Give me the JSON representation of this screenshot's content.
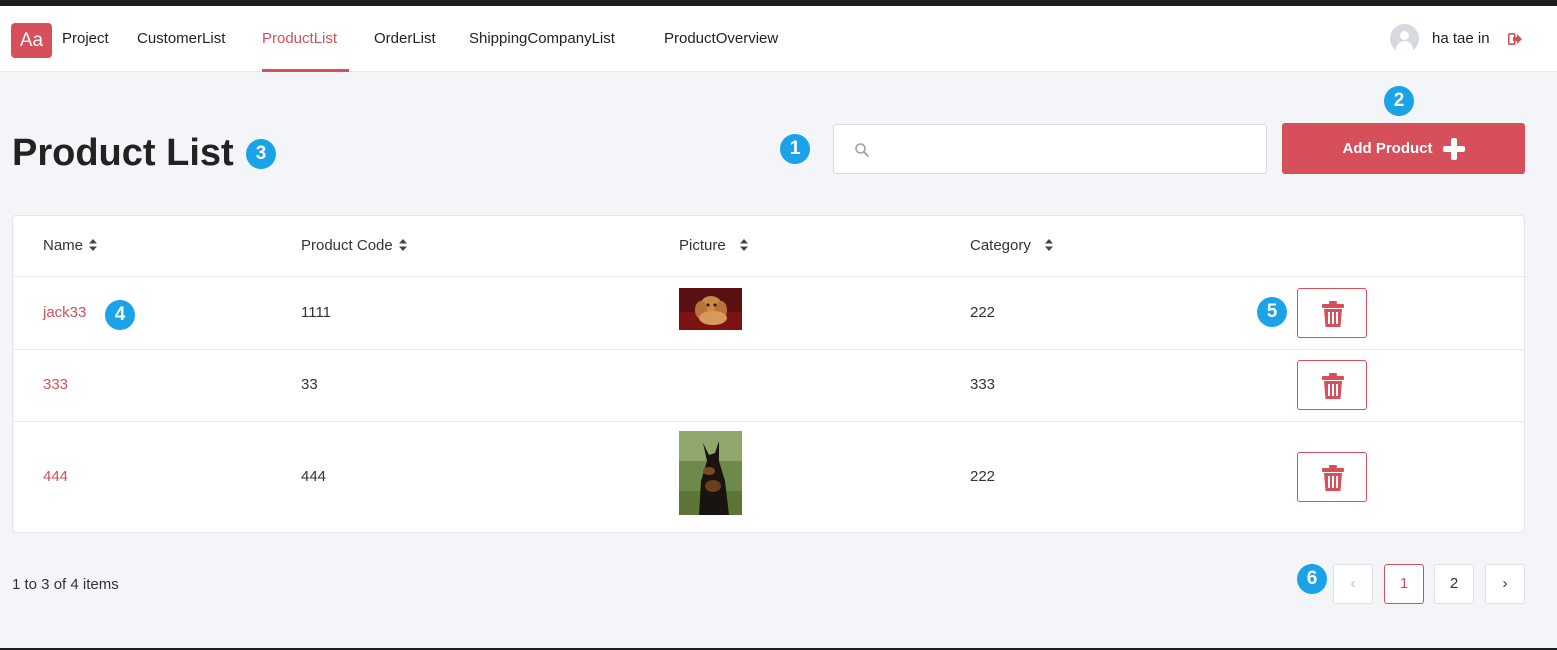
{
  "navbar": {
    "logo": "Aa",
    "items": [
      "Project",
      "CustomerList",
      "ProductList",
      "OrderList",
      "ShippingCompanyList",
      "ProductOverview"
    ],
    "active": "ProductList",
    "user_name": "ha tae in"
  },
  "page": {
    "title": "Product List",
    "search_placeholder": "",
    "add_button_label": "Add Product"
  },
  "badges": [
    "1",
    "2",
    "3",
    "4",
    "5",
    "6"
  ],
  "table": {
    "columns": [
      "Name",
      "Product Code",
      "Picture",
      "Category"
    ],
    "rows": [
      {
        "name": "jack33",
        "code": "1111",
        "picture": "puppy-photo",
        "category": "222"
      },
      {
        "name": "333",
        "code": "33",
        "picture": "",
        "category": "333"
      },
      {
        "name": "444",
        "code": "444",
        "picture": "doberman-photo",
        "category": "222"
      }
    ]
  },
  "pagination": {
    "info": "1 to 3 of 4 items",
    "prev": "‹",
    "pages": [
      "1",
      "2"
    ],
    "current": "1",
    "next": "›"
  },
  "colors": {
    "accent": "#d64f5b",
    "badge": "#1aa3e8",
    "background": "#f3f5f8"
  }
}
